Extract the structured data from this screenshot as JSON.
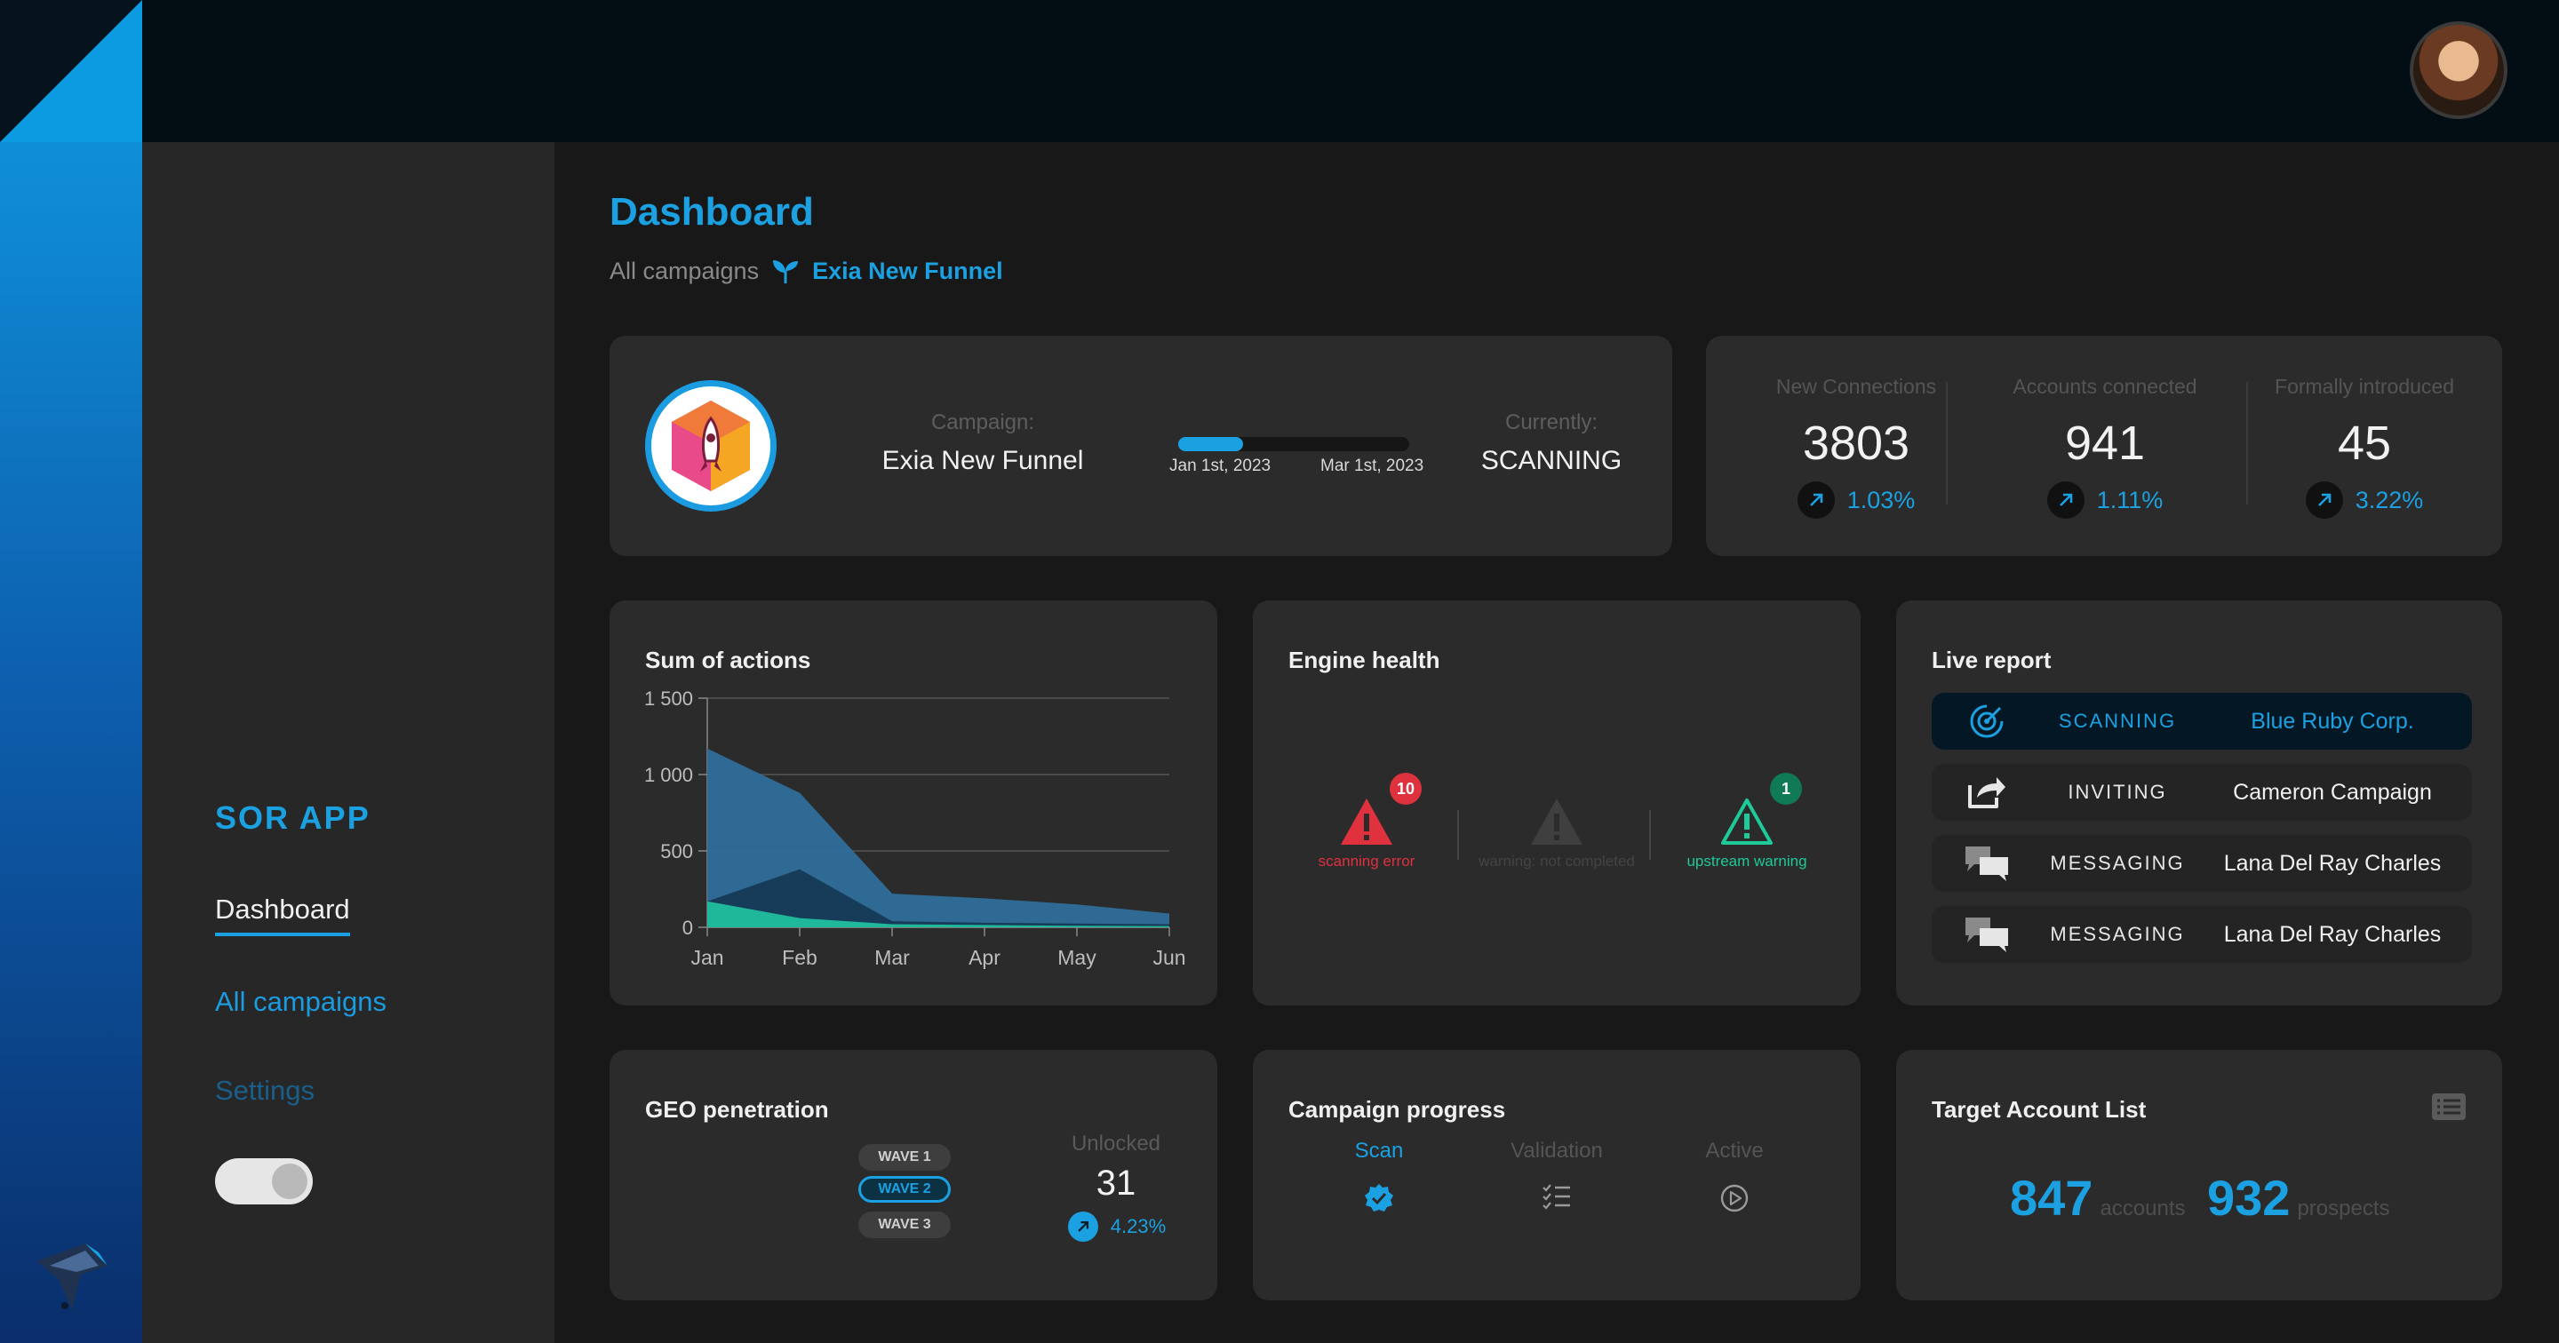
{
  "app": {
    "title": "SOR APP",
    "nav": [
      {
        "label": "Dashboard",
        "active": true
      },
      {
        "label": "All campaigns"
      },
      {
        "label": "Settings"
      }
    ],
    "toggle_on": true
  },
  "header": {
    "title": "Dashboard",
    "breadcrumb": [
      "All campaigns",
      "Exia New Funnel"
    ]
  },
  "campaign": {
    "campaign_label": "Campaign:",
    "name": "Exia New Funnel",
    "start_date": "Jan 1st, 2023",
    "end_date": "Mar 1st, 2023",
    "progress_fraction": 0.28,
    "status_label": "Currently:",
    "status": "SCANNING"
  },
  "stats": [
    {
      "label": "New Connections",
      "value": "3803",
      "trend": "1.03%"
    },
    {
      "label": "Accounts connected",
      "value": "941",
      "trend": "1.11%"
    },
    {
      "label": "Formally introduced",
      "value": "45",
      "trend": "3.22%"
    }
  ],
  "sum_of_actions": {
    "title": "Sum of actions"
  },
  "chart_data": {
    "type": "area",
    "title": "Sum of actions",
    "categories": [
      "Jan",
      "Feb",
      "Mar",
      "Apr",
      "May",
      "Jun"
    ],
    "yticks": [
      "0",
      "500",
      "1 000",
      "1 500"
    ],
    "ylim": [
      0,
      1500
    ],
    "series": [
      {
        "values": [
          1170,
          880,
          220,
          190,
          150,
          90
        ],
        "color": "#2f6e9a"
      },
      {
        "values": [
          170,
          380,
          40,
          30,
          25,
          20
        ],
        "color": "#163c5a"
      },
      {
        "values": [
          170,
          60,
          20,
          15,
          10,
          8
        ],
        "color": "#1fb89a"
      }
    ],
    "grid": true
  },
  "engine_health": {
    "title": "Engine health",
    "items": [
      {
        "label": "scanning error",
        "count": "10",
        "color": "#e0313f",
        "badge_color": "#e0313f"
      },
      {
        "label": "warning: not completed",
        "count": "",
        "color": "#3f3f3f",
        "badge_color": ""
      },
      {
        "label": "upstream warning",
        "count": "1",
        "color": "#1ec99a",
        "badge_color": "#0f7a55"
      }
    ]
  },
  "live_report": {
    "title": "Live report",
    "rows": [
      {
        "status": "SCANNING",
        "name": "Blue Ruby Corp.",
        "icon": "radar-icon",
        "active": true
      },
      {
        "status": "INVITING",
        "name": "Cameron Campaign",
        "icon": "share-icon"
      },
      {
        "status": "MESSAGING",
        "name": "Lana Del Ray Charles",
        "icon": "chat-icon"
      },
      {
        "status": "MESSAGING",
        "name": "Lana Del Ray Charles",
        "icon": "chat-icon"
      }
    ]
  },
  "geo": {
    "title": "GEO penetration",
    "waves": [
      "WAVE 1",
      "WAVE 2",
      "WAVE 3"
    ],
    "selected_wave": "WAVE 2",
    "unlocked_label": "Unlocked",
    "unlocked_value": "31",
    "trend": "4.23%"
  },
  "campaign_progress": {
    "title": "Campaign progress",
    "steps": [
      {
        "label": "Scan",
        "active": true
      },
      {
        "label": "Validation"
      },
      {
        "label": "Active"
      }
    ]
  },
  "target_accounts": {
    "title": "Target Account List",
    "accounts_count": "847",
    "accounts_label": "accounts",
    "prospects_count": "932",
    "prospects_label": "prospects"
  },
  "colors": {
    "accent": "#1ba1e2",
    "error": "#e0313f",
    "success": "#1ec99a"
  }
}
